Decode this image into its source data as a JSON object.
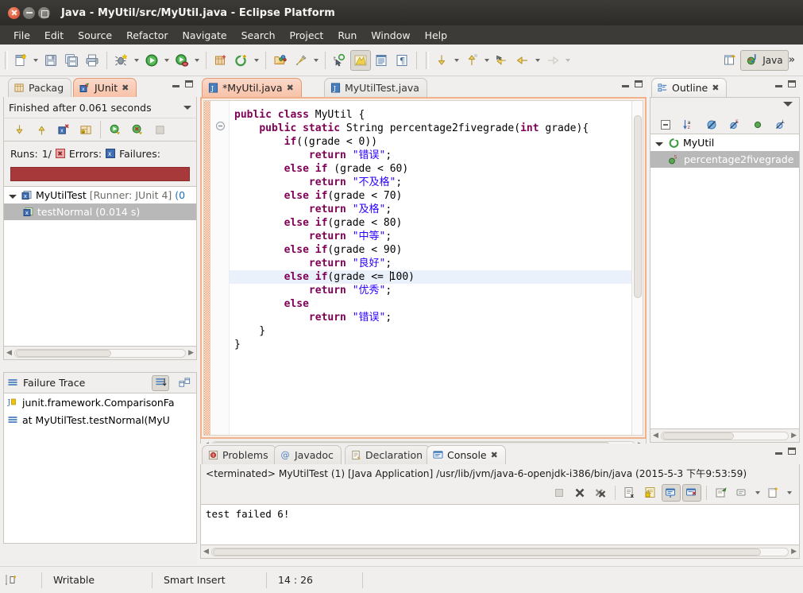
{
  "window": {
    "title": "Java - MyUtil/src/MyUtil.java - Eclipse Platform"
  },
  "menu": {
    "items": [
      {
        "label": "File"
      },
      {
        "label": "Edit"
      },
      {
        "label": "Source"
      },
      {
        "label": "Refactor"
      },
      {
        "label": "Navigate"
      },
      {
        "label": "Search"
      },
      {
        "label": "Project"
      },
      {
        "label": "Run"
      },
      {
        "label": "Window"
      },
      {
        "label": "Help"
      }
    ]
  },
  "toolbar": {
    "icons": [
      "new-wizard-icon",
      "save-icon",
      "save-all-icon",
      "print-icon",
      "debug-icon",
      "run-icon",
      "run-coverage-icon",
      "new-java-package-icon",
      "new-java-class-icon",
      "open-type-icon",
      "search-icon",
      "next-annotation-icon",
      "previous-annotation-icon",
      "last-edit-location-icon",
      "back-icon",
      "forward-icon",
      "toggle-mark-occurrences-icon",
      "show-whitespace-icon",
      "toggle-block-selection-icon"
    ],
    "perspective_label": "Java",
    "perspective_icon": "java-perspective-icon",
    "open-perspective-icon": "open-perspective-icon",
    "overflow_label": "»"
  },
  "junit": {
    "tabs": [
      {
        "label": "Packag",
        "icon": "package-explorer-icon",
        "active": false
      },
      {
        "label": "JUnit",
        "icon": "junit-icon",
        "active": true
      }
    ],
    "close_glyph": "✖",
    "status": "Finished after 0.061 seconds",
    "toolbar_icons": [
      "next-failure-icon",
      "previous-failure-icon",
      "show-failures-only-icon",
      "show-test-hierarchy-icon",
      "rerun-test-icon",
      "rerun-failed-tests-icon",
      "stop-icon"
    ],
    "counters": {
      "runs_label": "Runs:",
      "runs_value": "1/",
      "errors_label": "Errors:",
      "failures_label": "Failures:",
      "bar_color": "#a8393b"
    },
    "tree": [
      {
        "label": "MyUtilTest ",
        "suffix": "[Runner: JUnit 4] ",
        "extra": "(0",
        "selected": false,
        "icon": "test-class-icon"
      },
      {
        "label": "testNormal (0.014 s)",
        "suffix": "",
        "extra": "",
        "selected": true,
        "icon": "test-method-icon"
      }
    ]
  },
  "failure_trace": {
    "title": "Failure Trace",
    "title_icon": "stack-trace-icon",
    "buttons": [
      "filter-stack-trace-icon",
      "compare-result-icon"
    ],
    "rows": [
      {
        "icon": "exception-icon",
        "label": "junit.framework.ComparisonFa"
      },
      {
        "icon": "stack-frame-icon",
        "label": "at MyUtilTest.testNormal(MyU"
      }
    ]
  },
  "editor": {
    "tabs": [
      {
        "label": "*MyUtil.java",
        "icon": "java-file-icon",
        "active": true,
        "close_glyph": "✖"
      },
      {
        "label": "MyUtilTest.java",
        "icon": "java-file-icon",
        "active": false,
        "close_glyph": ""
      }
    ],
    "lines": [
      {
        "tokens": [
          {
            "t": "public",
            "c": "kw"
          },
          {
            "t": " ",
            "c": "pl"
          },
          {
            "t": "class",
            "c": "kw"
          },
          {
            "t": " MyUtil {",
            "c": "pl"
          }
        ],
        "indent": 0,
        "highlight": false
      },
      {
        "tokens": [
          {
            "t": "    ",
            "c": "pl"
          },
          {
            "t": "public",
            "c": "kw"
          },
          {
            "t": " ",
            "c": "pl"
          },
          {
            "t": "static",
            "c": "kw"
          },
          {
            "t": " String percentage2fivegrade(",
            "c": "pl"
          },
          {
            "t": "int",
            "c": "kw"
          },
          {
            "t": " grade){",
            "c": "pl"
          }
        ],
        "indent": 0,
        "highlight": false
      },
      {
        "tokens": [
          {
            "t": "        ",
            "c": "pl"
          },
          {
            "t": "if",
            "c": "kw"
          },
          {
            "t": "((grade < 0))",
            "c": "pl"
          }
        ],
        "indent": 0,
        "highlight": false
      },
      {
        "tokens": [
          {
            "t": "            ",
            "c": "pl"
          },
          {
            "t": "return",
            "c": "kw"
          },
          {
            "t": " ",
            "c": "pl"
          },
          {
            "t": "\"错误\"",
            "c": "str"
          },
          {
            "t": ";",
            "c": "pl"
          }
        ],
        "indent": 0,
        "highlight": false
      },
      {
        "tokens": [
          {
            "t": "        ",
            "c": "pl"
          },
          {
            "t": "else",
            "c": "kw"
          },
          {
            "t": " ",
            "c": "pl"
          },
          {
            "t": "if",
            "c": "kw"
          },
          {
            "t": " (grade < 60)",
            "c": "pl"
          }
        ],
        "indent": 0,
        "highlight": false
      },
      {
        "tokens": [
          {
            "t": "            ",
            "c": "pl"
          },
          {
            "t": "return",
            "c": "kw"
          },
          {
            "t": " ",
            "c": "pl"
          },
          {
            "t": "\"不及格\"",
            "c": "str"
          },
          {
            "t": ";",
            "c": "pl"
          }
        ],
        "indent": 0,
        "highlight": false
      },
      {
        "tokens": [
          {
            "t": "        ",
            "c": "pl"
          },
          {
            "t": "else",
            "c": "kw"
          },
          {
            "t": " ",
            "c": "pl"
          },
          {
            "t": "if",
            "c": "kw"
          },
          {
            "t": "(grade < 70)",
            "c": "pl"
          }
        ],
        "indent": 0,
        "highlight": false
      },
      {
        "tokens": [
          {
            "t": "            ",
            "c": "pl"
          },
          {
            "t": "return",
            "c": "kw"
          },
          {
            "t": " ",
            "c": "pl"
          },
          {
            "t": "\"及格\"",
            "c": "str"
          },
          {
            "t": ";",
            "c": "pl"
          }
        ],
        "indent": 0,
        "highlight": false
      },
      {
        "tokens": [
          {
            "t": "        ",
            "c": "pl"
          },
          {
            "t": "else",
            "c": "kw"
          },
          {
            "t": " ",
            "c": "pl"
          },
          {
            "t": "if",
            "c": "kw"
          },
          {
            "t": "(grade < 80)",
            "c": "pl"
          }
        ],
        "indent": 0,
        "highlight": false
      },
      {
        "tokens": [
          {
            "t": "            ",
            "c": "pl"
          },
          {
            "t": "return",
            "c": "kw"
          },
          {
            "t": " ",
            "c": "pl"
          },
          {
            "t": "\"中等\"",
            "c": "str"
          },
          {
            "t": ";",
            "c": "pl"
          }
        ],
        "indent": 0,
        "highlight": false
      },
      {
        "tokens": [
          {
            "t": "        ",
            "c": "pl"
          },
          {
            "t": "else",
            "c": "kw"
          },
          {
            "t": " ",
            "c": "pl"
          },
          {
            "t": "if",
            "c": "kw"
          },
          {
            "t": "(grade < 90)",
            "c": "pl"
          }
        ],
        "indent": 0,
        "highlight": false
      },
      {
        "tokens": [
          {
            "t": "            ",
            "c": "pl"
          },
          {
            "t": "return",
            "c": "kw"
          },
          {
            "t": " ",
            "c": "pl"
          },
          {
            "t": "\"良好\"",
            "c": "str"
          },
          {
            "t": ";",
            "c": "pl"
          }
        ],
        "indent": 0,
        "highlight": false
      },
      {
        "tokens": [
          {
            "t": "        ",
            "c": "pl"
          },
          {
            "t": "else",
            "c": "kw"
          },
          {
            "t": " ",
            "c": "pl"
          },
          {
            "t": "if",
            "c": "kw"
          },
          {
            "t": "(grade <= ",
            "c": "pl"
          },
          {
            "t": "|",
            "c": "caret"
          },
          {
            "t": "100)",
            "c": "pl"
          }
        ],
        "indent": 0,
        "highlight": true
      },
      {
        "tokens": [
          {
            "t": "            ",
            "c": "pl"
          },
          {
            "t": "return",
            "c": "kw"
          },
          {
            "t": " ",
            "c": "pl"
          },
          {
            "t": "\"优秀\"",
            "c": "str"
          },
          {
            "t": ";",
            "c": "pl"
          }
        ],
        "indent": 0,
        "highlight": false
      },
      {
        "tokens": [
          {
            "t": "        ",
            "c": "pl"
          },
          {
            "t": "else",
            "c": "kw"
          }
        ],
        "indent": 0,
        "highlight": false
      },
      {
        "tokens": [
          {
            "t": "            ",
            "c": "pl"
          },
          {
            "t": "return",
            "c": "kw"
          },
          {
            "t": " ",
            "c": "pl"
          },
          {
            "t": "\"错误\"",
            "c": "str"
          },
          {
            "t": ";",
            "c": "pl"
          }
        ],
        "indent": 0,
        "highlight": false
      },
      {
        "tokens": [
          {
            "t": "    }",
            "c": "pl"
          }
        ],
        "indent": 0,
        "highlight": false
      },
      {
        "tokens": [
          {
            "t": "}",
            "c": "pl"
          }
        ],
        "indent": 0,
        "highlight": false
      }
    ]
  },
  "outline": {
    "tab_label": "Outline",
    "tab_icon": "outline-icon",
    "close_glyph": "✖",
    "toolbar_icons": [
      "collapse-all-icon",
      "sort-icon",
      "hide-fields-icon",
      "hide-static-icon",
      "hide-nonpublic-icon",
      "hide-local-types-icon"
    ],
    "menu_icon": "view-menu-icon",
    "tree": [
      {
        "label": "MyUtil",
        "icon": "class-icon",
        "selected": false,
        "expander": true
      },
      {
        "label": "percentage2fivegrade",
        "icon": "public-method-icon",
        "selected": true,
        "expander": false,
        "badge": "S"
      }
    ]
  },
  "console": {
    "tabs": [
      {
        "label": "Problems",
        "icon": "problems-icon",
        "active": false
      },
      {
        "label": "Javadoc",
        "icon": "javadoc-icon",
        "active": false
      },
      {
        "label": "Declaration",
        "icon": "declaration-icon",
        "active": false
      },
      {
        "label": "Console",
        "icon": "console-icon",
        "active": true
      }
    ],
    "close_glyph": "✖",
    "launch_line": "<terminated> MyUtilTest (1) [Java Application] /usr/lib/jvm/java-6-openjdk-i386/bin/java (2015-5-3 下午9:53:59)",
    "toolbar_icons": [
      "terminate-icon",
      "remove-launch-icon",
      "remove-all-launches-icon",
      "clear-console-icon",
      "scroll-lock-icon",
      "show-console-on-output-icon",
      "show-console-on-error-icon",
      "pin-console-icon",
      "display-selected-console-icon",
      "open-console-icon"
    ],
    "output": "test failed 6!"
  },
  "statusbar": {
    "icon": "smart-insert-icon",
    "writable": "Writable",
    "insert_mode": "Smart Insert",
    "position": "14 : 26"
  }
}
